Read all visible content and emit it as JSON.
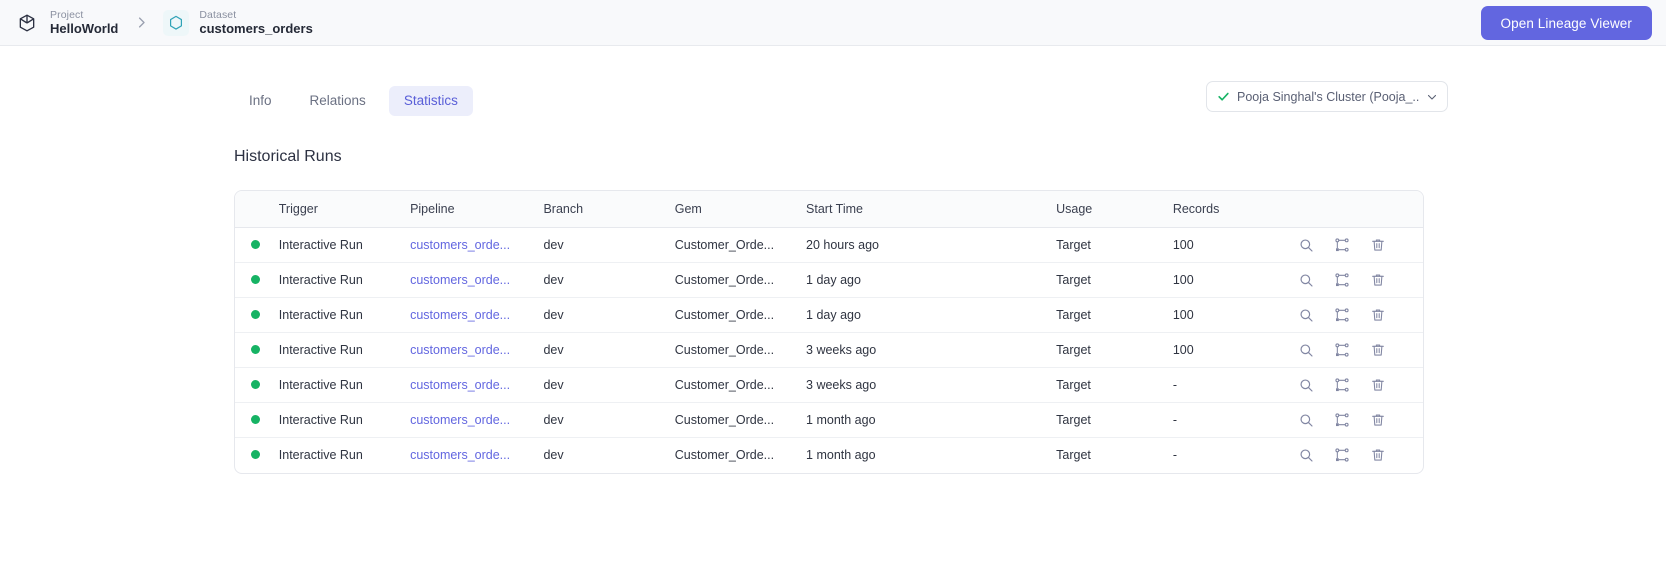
{
  "topbar": {
    "project": {
      "label": "Project",
      "value": "HelloWorld",
      "icon": "cube-icon"
    },
    "dataset": {
      "label": "Dataset",
      "value": "customers_orders",
      "icon": "hexagon-icon"
    },
    "separator_icon": "chevron-right-icon",
    "primary_button": "Open Lineage Viewer"
  },
  "tabs": [
    {
      "label": "Info",
      "active": false
    },
    {
      "label": "Relations",
      "active": false
    },
    {
      "label": "Statistics",
      "active": true
    }
  ],
  "cluster": {
    "status_icon": "check-icon",
    "name": "Pooja Singhal's Cluster (Pooja_...",
    "chevron_icon": "chevron-down-icon"
  },
  "section": {
    "title": "Historical Runs"
  },
  "table": {
    "columns": [
      "",
      "Trigger",
      "Pipeline",
      "Branch",
      "Gem",
      "Start Time",
      "Usage",
      "Records",
      ""
    ],
    "row_actions": [
      "search-icon",
      "lineage-graph-icon",
      "trash-icon"
    ],
    "rows": [
      {
        "status": "green",
        "trigger": "Interactive Run",
        "pipeline": "customers_orde...",
        "branch": "dev",
        "gem": "Customer_Orde...",
        "start_time": "20 hours ago",
        "usage": "Target",
        "records": "100"
      },
      {
        "status": "green",
        "trigger": "Interactive Run",
        "pipeline": "customers_orde...",
        "branch": "dev",
        "gem": "Customer_Orde...",
        "start_time": "1 day ago",
        "usage": "Target",
        "records": "100"
      },
      {
        "status": "green",
        "trigger": "Interactive Run",
        "pipeline": "customers_orde...",
        "branch": "dev",
        "gem": "Customer_Orde...",
        "start_time": "1 day ago",
        "usage": "Target",
        "records": "100"
      },
      {
        "status": "green",
        "trigger": "Interactive Run",
        "pipeline": "customers_orde...",
        "branch": "dev",
        "gem": "Customer_Orde...",
        "start_time": "3 weeks ago",
        "usage": "Target",
        "records": "100"
      },
      {
        "status": "green",
        "trigger": "Interactive Run",
        "pipeline": "customers_orde...",
        "branch": "dev",
        "gem": "Customer_Orde...",
        "start_time": "3 weeks ago",
        "usage": "Target",
        "records": "-"
      },
      {
        "status": "green",
        "trigger": "Interactive Run",
        "pipeline": "customers_orde...",
        "branch": "dev",
        "gem": "Customer_Orde...",
        "start_time": "1 month ago",
        "usage": "Target",
        "records": "-"
      },
      {
        "status": "green",
        "trigger": "Interactive Run",
        "pipeline": "customers_orde...",
        "branch": "dev",
        "gem": "Customer_Orde...",
        "start_time": "1 month ago",
        "usage": "Target",
        "records": "-"
      }
    ]
  },
  "colors": {
    "accent": "#6266e0",
    "accent_soft": "#eceefb",
    "status_green": "#16b364",
    "dataset_teal": "#2fa3b7",
    "topbar_bg": "#f8f9fb"
  }
}
